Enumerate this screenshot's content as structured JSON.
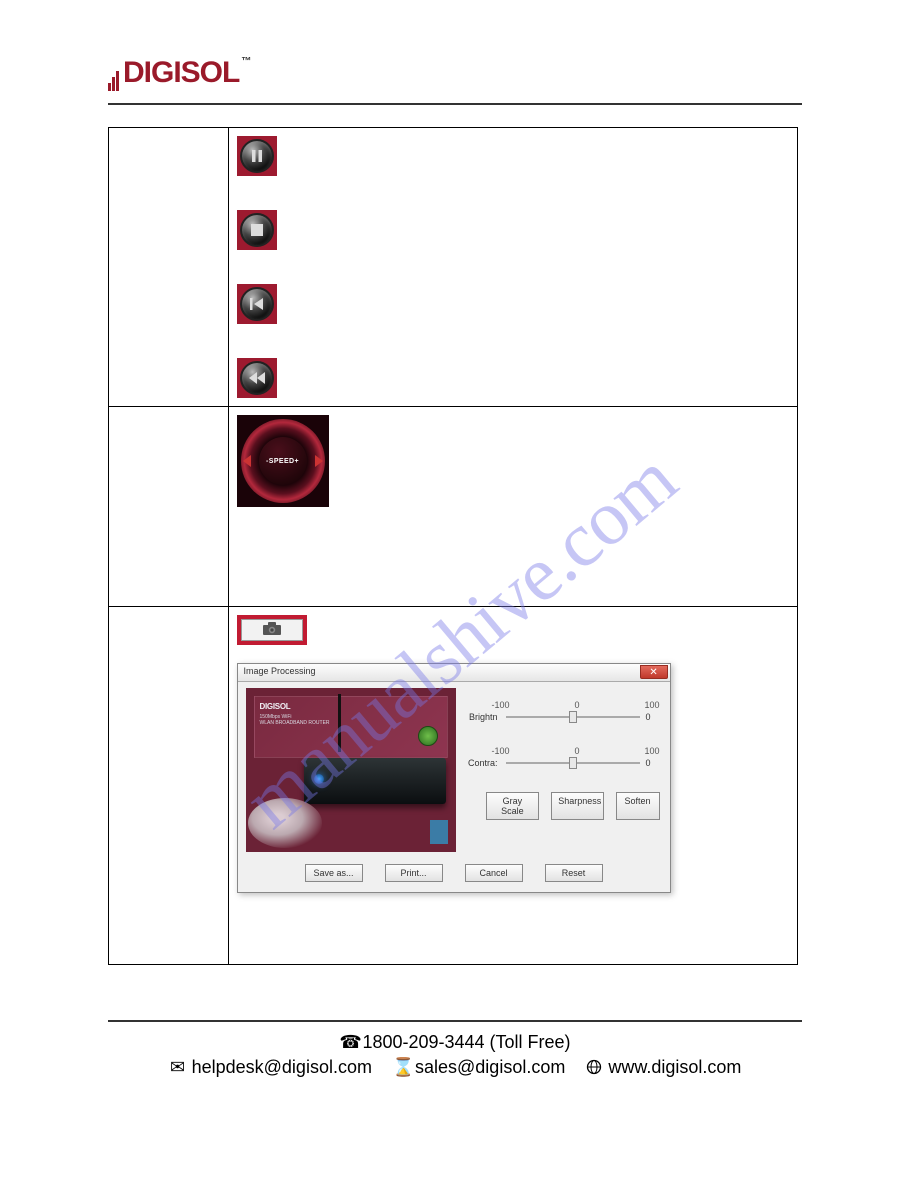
{
  "brand": {
    "name": "DIGISOL"
  },
  "icons": {
    "pause": "pause",
    "stop": "stop",
    "skip_back": "skip-back",
    "rewind": "rewind",
    "speed_label": "SPEED",
    "camera": "camera"
  },
  "dialog": {
    "title": "Image Processing",
    "preview_brand": "DIGISOL",
    "preview_desc1": "150Mbps WiFi",
    "preview_desc2": "WLAN BROADBAND ROUTER",
    "brightness": {
      "label": "Brightn",
      "min": "-100",
      "mid": "0",
      "max": "100",
      "value": "0"
    },
    "contrast": {
      "label": "Contra:",
      "min": "-100",
      "mid": "0",
      "max": "100",
      "value": "0"
    },
    "buttons": {
      "gray": "Gray Scale",
      "sharp": "Sharpness",
      "soften": "Soften",
      "save": "Save as...",
      "print": "Print...",
      "cancel": "Cancel",
      "reset": "Reset"
    }
  },
  "watermark": "manualshive.com",
  "footer": {
    "phone": "1800-209-3444 (Toll Free)",
    "helpdesk": "helpdesk@digisol.com",
    "sales": "sales@digisol.com",
    "website": "www.digisol.com"
  }
}
